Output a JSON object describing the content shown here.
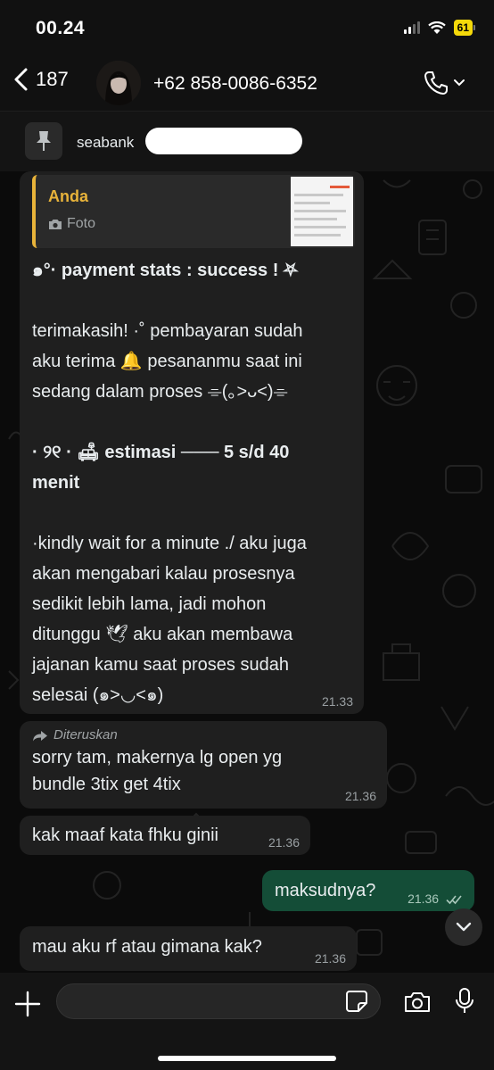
{
  "status_bar": {
    "time": "00.24",
    "battery": "61"
  },
  "header": {
    "back_count": "187",
    "contact": "+62 858-0086-6352"
  },
  "pinned": {
    "text": "seabank"
  },
  "messages": {
    "m1": {
      "quote_author": "Anda",
      "quote_type": "Foto",
      "lines": [
        "๑°· payment stats : success !  ⛧",
        "terimakasih! ·˚ pembayaran sudah",
        "aku terima 🔔 pesananmu saat ini",
        "sedang dalam proses ⌯(｡>ᴗ<)⌯",
        "· ୨୧ · 🛋 estimasi ─── 5 s/d 40",
        "menit",
        "·kindly wait for a minute ./ aku juga",
        "akan mengabari kalau prosesnya",
        "sedikit lebih lama,  jadi mohon",
        "ditunggu 🕊 aku akan membawa",
        "jajanan kamu saat proses sudah",
        "selesai (๑>◡<๑)"
      ],
      "time": "21.33"
    },
    "m2": {
      "forwarded": "Diteruskan",
      "lines": [
        "sorry tam, makernya lg open yg",
        "bundle 3tix get 4tix"
      ],
      "time": "21.36"
    },
    "m3": {
      "text": "kak maaf kata fhku ginii",
      "time": "21.36"
    },
    "m4": {
      "text": "maksudnya?",
      "time": "21.36"
    },
    "m5": {
      "text": "mau aku rf atau gimana kak?",
      "time": "21.36"
    }
  },
  "colors": {
    "outgoing": "#144d37",
    "incoming": "#1f1f1f",
    "quote_accent": "#e8b33a"
  }
}
